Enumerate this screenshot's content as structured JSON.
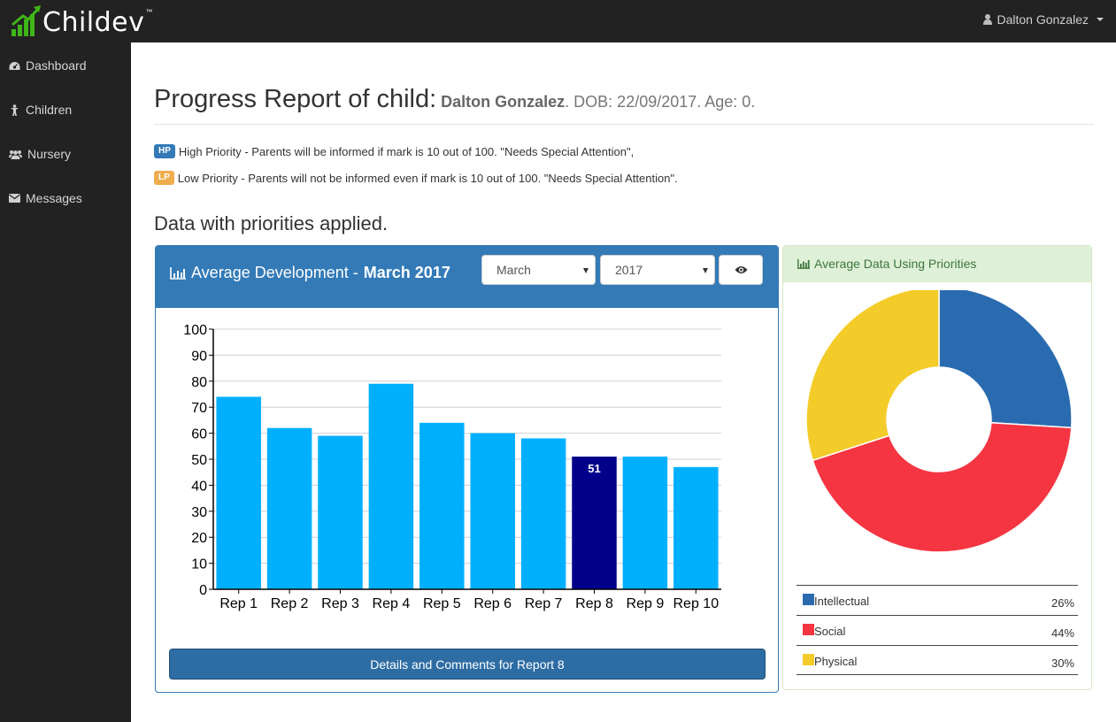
{
  "app": {
    "name": "Childev",
    "tm": "™",
    "user": "Dalton Gonzalez",
    "colors": {
      "brand_green": "#3fb618",
      "navbar": "#222222",
      "primary": "#337ab7"
    }
  },
  "sidebar": {
    "items": [
      {
        "label": "Dashboard",
        "icon": "dashboard-icon"
      },
      {
        "label": "Children",
        "icon": "child-icon"
      },
      {
        "label": "Nursery",
        "icon": "users-icon"
      },
      {
        "label": "Messages",
        "icon": "envelope-icon"
      }
    ]
  },
  "page": {
    "title_prefix": "Progress Report of child:",
    "child_name": "Dalton Gonzalez",
    "child_info": ". DOB: 22/09/2017. Age: 0.",
    "hp_badge": "HP",
    "hp_text": "High Priority - Parents will be informed if mark is 10 out of 100. \"Needs Special Attention\",",
    "lp_badge": "LP",
    "lp_text": "Low Priority - Parents will not be informed even if mark is 10 out of 100. \"Needs Special Attention\".",
    "section_title": "Data with priorities applied."
  },
  "bar_panel": {
    "title": "Average Development -",
    "title_bold": "March 2017",
    "month_select": "March",
    "year_select": "2017",
    "details_button": "Details and Comments for Report 8"
  },
  "pie_panel": {
    "title": "Average Data Using Priorities",
    "legend": [
      {
        "label": "Intellectual",
        "pct": "26%",
        "color": "#2a6bb0"
      },
      {
        "label": "Social",
        "pct": "44%",
        "color": "#f53541"
      },
      {
        "label": "Physical",
        "pct": "30%",
        "color": "#f4cc2a"
      }
    ]
  },
  "chart_data": [
    {
      "type": "bar",
      "categories": [
        "Rep 1",
        "Rep 2",
        "Rep 3",
        "Rep 4",
        "Rep 5",
        "Rep 6",
        "Rep 7",
        "Rep 8",
        "Rep 9",
        "Rep 10"
      ],
      "values": [
        74,
        62,
        59,
        79,
        64,
        60,
        58,
        51,
        51,
        47
      ],
      "highlighted_index": 7,
      "highlight_label": "51",
      "bar_color": "#00b0ff",
      "highlight_color": "#00008b",
      "ylim": [
        0,
        100
      ],
      "yticks": [
        0,
        10,
        20,
        30,
        40,
        50,
        60,
        70,
        80,
        90,
        100
      ],
      "grid": true
    },
    {
      "type": "pie",
      "labels": [
        "Intellectual",
        "Social",
        "Physical"
      ],
      "values": [
        26,
        44,
        30
      ],
      "colors": [
        "#2a6bb0",
        "#f53541",
        "#f4cc2a"
      ],
      "donut": true
    }
  ]
}
